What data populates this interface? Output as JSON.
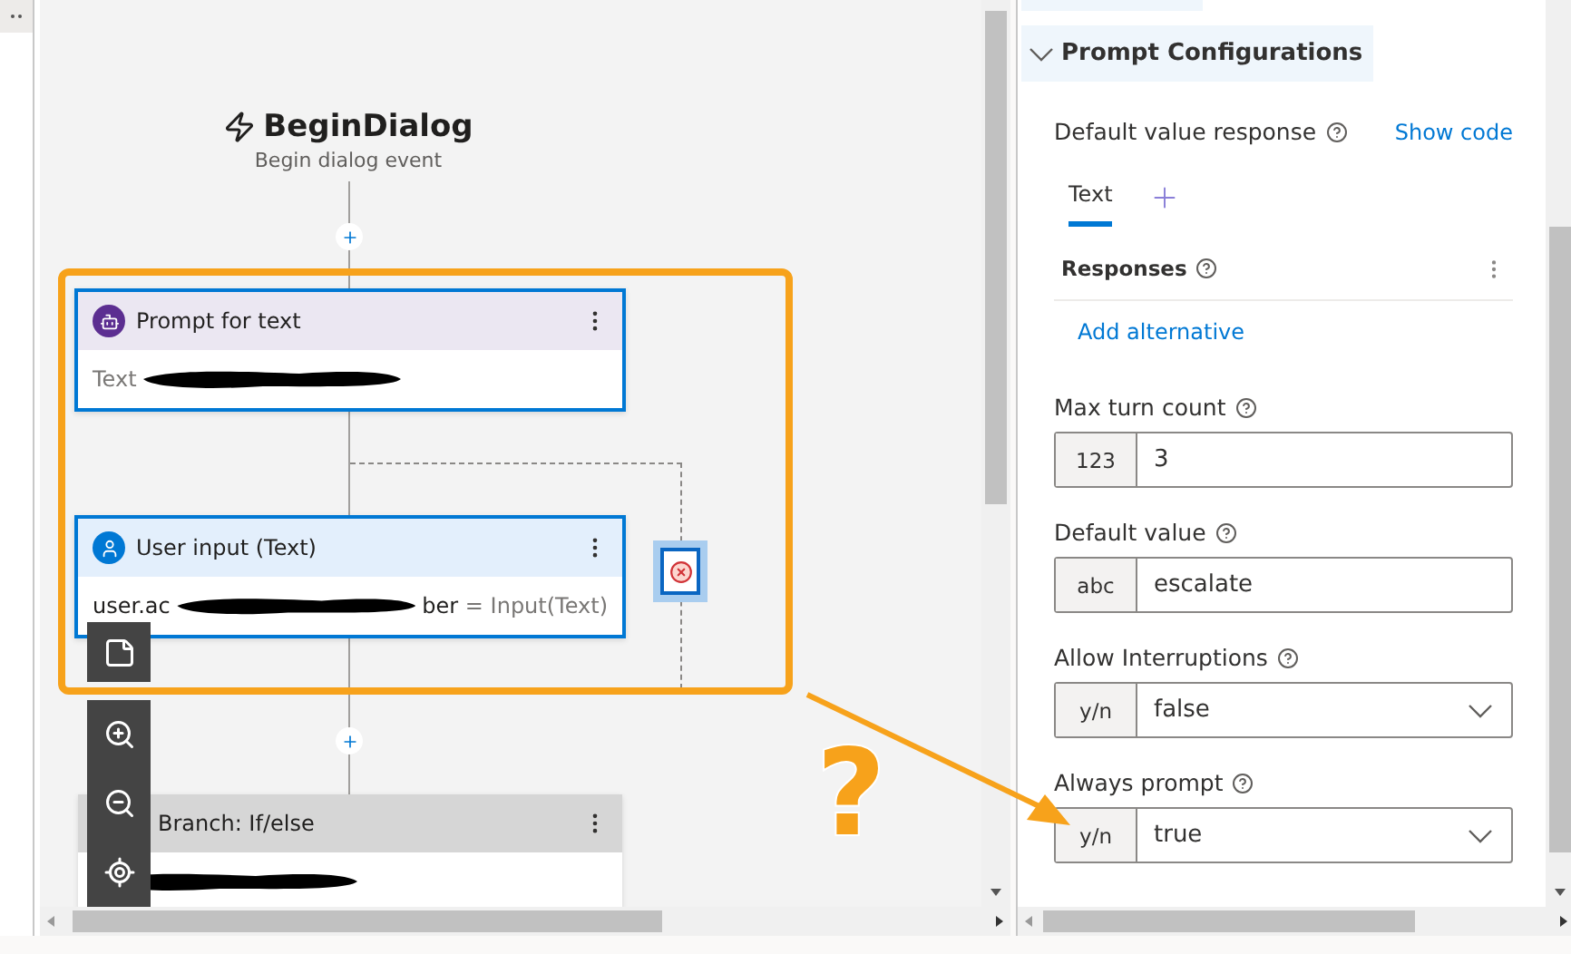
{
  "flow": {
    "event": {
      "title": "BeginDialog",
      "subtitle": "Begin dialog event"
    },
    "nodes": [
      {
        "kind": "prompt",
        "title": "Prompt for text",
        "body": [
          {
            "kind": "muted",
            "text": "Text"
          },
          {
            "kind": "redacted"
          }
        ]
      },
      {
        "kind": "input",
        "title": "User input (Text)",
        "body": [
          {
            "kind": "plain",
            "text": "user.ac"
          },
          {
            "kind": "redacted"
          },
          {
            "kind": "plain",
            "text": "ber"
          },
          {
            "kind": "muted",
            "text": " = Input(Text)"
          }
        ]
      },
      {
        "kind": "branch",
        "title": "Branch: If/else",
        "body": [
          {
            "kind": "redacted"
          }
        ]
      }
    ],
    "callout": {
      "mark": "?"
    }
  },
  "panel": {
    "section": {
      "title": "Prompt Configurations",
      "expanded": true
    },
    "default_response": {
      "label": "Default value response",
      "link": "Show code"
    },
    "tabs": [
      {
        "label": "Text",
        "selected": true
      }
    ],
    "responses": {
      "label": "Responses",
      "add_link": "Add alternative"
    },
    "fields": [
      {
        "kind": "input",
        "label": "Max turn count",
        "prefix": "123",
        "value": "3"
      },
      {
        "kind": "input",
        "label": "Default value",
        "prefix": "abc",
        "value": "escalate"
      },
      {
        "kind": "select",
        "label": "Allow Interruptions",
        "prefix": "y/n",
        "value": "false"
      },
      {
        "kind": "select",
        "label": "Always prompt",
        "prefix": "y/n",
        "value": "true"
      }
    ]
  }
}
